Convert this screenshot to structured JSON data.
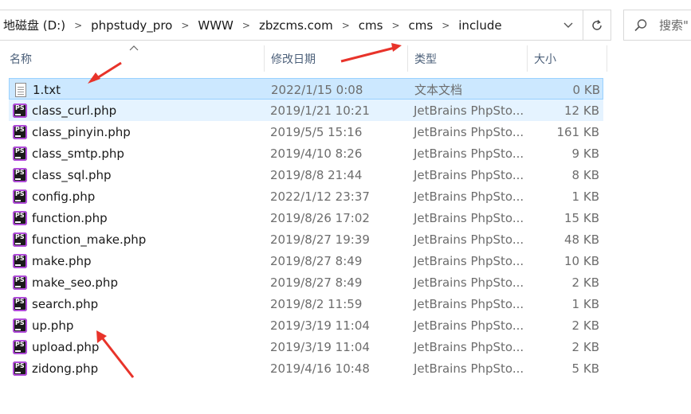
{
  "address": {
    "crumbs": [
      "地磁盘 (D:)",
      "phpstudy_pro",
      "WWW",
      "zbzcms.com",
      "cms",
      "cms",
      "include"
    ],
    "search_placeholder": "搜索\""
  },
  "columns": {
    "name": "名称",
    "date": "修改日期",
    "type": "类型",
    "size": "大小"
  },
  "files": [
    {
      "name": "1.txt",
      "date": "2022/1/15 0:08",
      "type": "文本文档",
      "size": "0 KB",
      "icon": "text-file-icon",
      "state": "selected"
    },
    {
      "name": "class_curl.php",
      "date": "2019/1/21 10:21",
      "type": "JetBrains PhpSto...",
      "size": "12 KB",
      "icon": "phpstorm-file-icon",
      "state": "hover"
    },
    {
      "name": "class_pinyin.php",
      "date": "2019/5/5 15:16",
      "type": "JetBrains PhpSto...",
      "size": "161 KB",
      "icon": "phpstorm-file-icon",
      "state": ""
    },
    {
      "name": "class_smtp.php",
      "date": "2019/4/10 8:26",
      "type": "JetBrains PhpSto...",
      "size": "9 KB",
      "icon": "phpstorm-file-icon",
      "state": ""
    },
    {
      "name": "class_sql.php",
      "date": "2019/8/8 21:44",
      "type": "JetBrains PhpSto...",
      "size": "8 KB",
      "icon": "phpstorm-file-icon",
      "state": ""
    },
    {
      "name": "config.php",
      "date": "2022/1/12 23:37",
      "type": "JetBrains PhpSto...",
      "size": "1 KB",
      "icon": "phpstorm-file-icon",
      "state": ""
    },
    {
      "name": "function.php",
      "date": "2019/8/26 17:02",
      "type": "JetBrains PhpSto...",
      "size": "15 KB",
      "icon": "phpstorm-file-icon",
      "state": ""
    },
    {
      "name": "function_make.php",
      "date": "2019/8/27 19:39",
      "type": "JetBrains PhpSto...",
      "size": "48 KB",
      "icon": "phpstorm-file-icon",
      "state": ""
    },
    {
      "name": "make.php",
      "date": "2019/8/27 8:49",
      "type": "JetBrains PhpSto...",
      "size": "10 KB",
      "icon": "phpstorm-file-icon",
      "state": ""
    },
    {
      "name": "make_seo.php",
      "date": "2019/8/27 8:49",
      "type": "JetBrains PhpSto...",
      "size": "2 KB",
      "icon": "phpstorm-file-icon",
      "state": ""
    },
    {
      "name": "search.php",
      "date": "2019/8/2 11:59",
      "type": "JetBrains PhpSto...",
      "size": "1 KB",
      "icon": "phpstorm-file-icon",
      "state": ""
    },
    {
      "name": "up.php",
      "date": "2019/3/19 11:04",
      "type": "JetBrains PhpSto...",
      "size": "2 KB",
      "icon": "phpstorm-file-icon",
      "state": ""
    },
    {
      "name": "upload.php",
      "date": "2019/3/19 11:04",
      "type": "JetBrains PhpSto...",
      "size": "2 KB",
      "icon": "phpstorm-file-icon",
      "state": ""
    },
    {
      "name": "zidong.php",
      "date": "2019/4/16 10:48",
      "type": "JetBrains PhpSto...",
      "size": "5 KB",
      "icon": "phpstorm-file-icon",
      "state": ""
    }
  ],
  "colors": {
    "selected_bg": "#cce8ff",
    "hover_bg": "#e5f3ff",
    "annotation_arrow": "#e8332a"
  }
}
